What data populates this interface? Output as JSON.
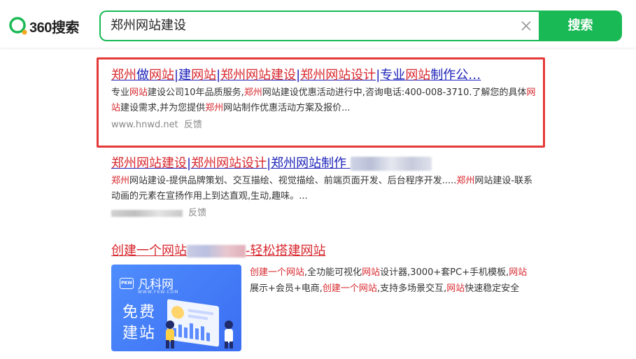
{
  "brand": {
    "logo_text": "360搜索",
    "accent_color": "#19b955"
  },
  "search": {
    "query": "郑州网站建设",
    "button_label": "搜索",
    "clear_icon": "close-icon"
  },
  "results": [
    {
      "title_parts": [
        {
          "t": "郑州",
          "hl": true
        },
        {
          "t": "做",
          "hl": false
        },
        {
          "t": "网站",
          "hl": true
        },
        {
          "t": "|建",
          "hl": false
        },
        {
          "t": "网站",
          "hl": true
        },
        {
          "t": "|",
          "hl": false
        },
        {
          "t": "郑州网站建设",
          "hl": true
        },
        {
          "t": "|",
          "hl": false
        },
        {
          "t": "郑州网站设计",
          "hl": true
        },
        {
          "t": "|专业",
          "hl": false
        },
        {
          "t": "网站",
          "hl": true
        },
        {
          "t": "制作公…",
          "hl": false
        }
      ],
      "desc_parts": [
        {
          "t": "专业",
          "hl": false
        },
        {
          "t": "网站",
          "hl": true
        },
        {
          "t": "建设公司10年品质服务,",
          "hl": false
        },
        {
          "t": "郑州",
          "hl": true
        },
        {
          "t": "网站建设优惠活动进行中,咨询电话:400-008-3710.了解您的具体",
          "hl": false
        },
        {
          "t": "网站",
          "hl": true
        },
        {
          "t": "建设需求,并为您提供",
          "hl": false
        },
        {
          "t": "郑州",
          "hl": true
        },
        {
          "t": "网站制作优惠活动方案及报价...",
          "hl": false
        }
      ],
      "url": "www.hnwd.net",
      "feedback": "反馈"
    },
    {
      "title_parts": [
        {
          "t": "郑州网站建设",
          "hl": true
        },
        {
          "t": "|",
          "hl": false
        },
        {
          "t": "郑州网站设计",
          "hl": true
        },
        {
          "t": "|",
          "hl": false
        },
        {
          "t": "郑州网站制作",
          "hl": false
        }
      ],
      "desc_parts": [
        {
          "t": "郑州",
          "hl": true
        },
        {
          "t": "网站建设-提供品牌策划、交互描绘、视觉描绘、前端页面开发、后台程序开发.....",
          "hl": false
        },
        {
          "t": "郑州",
          "hl": true
        },
        {
          "t": "网站建设-联系动画的元素在宣扬作用上到达直观,生动,趣味。...",
          "hl": false
        }
      ],
      "feedback": "反馈"
    },
    {
      "title_a": "创建一个网站",
      "title_b": "-轻松搭建网站",
      "ad_image": {
        "brand_mark": "PKW",
        "brand_name": "凡科网",
        "brand_url": "WWW.FKW.COM",
        "slogan_line1": "免费",
        "slogan_line2": "建站"
      },
      "desc_parts": [
        {
          "t": "创建一个网站",
          "hl": true
        },
        {
          "t": ",全功能可视化",
          "hl": false
        },
        {
          "t": "网站",
          "hl": true
        },
        {
          "t": "设计器,3000+套PC+手机模板,",
          "hl": false
        },
        {
          "t": "网站",
          "hl": true
        },
        {
          "t": "展示+会员+电商,",
          "hl": false
        },
        {
          "t": "创建一个网站",
          "hl": true
        },
        {
          "t": ",支持多场景交互,",
          "hl": false
        },
        {
          "t": "网站",
          "hl": true
        },
        {
          "t": "快速稳定安全",
          "hl": false
        }
      ]
    }
  ],
  "colors": {
    "link": "#1d22b8",
    "keyword": "#d8282e",
    "frame": "#e53a3a"
  }
}
